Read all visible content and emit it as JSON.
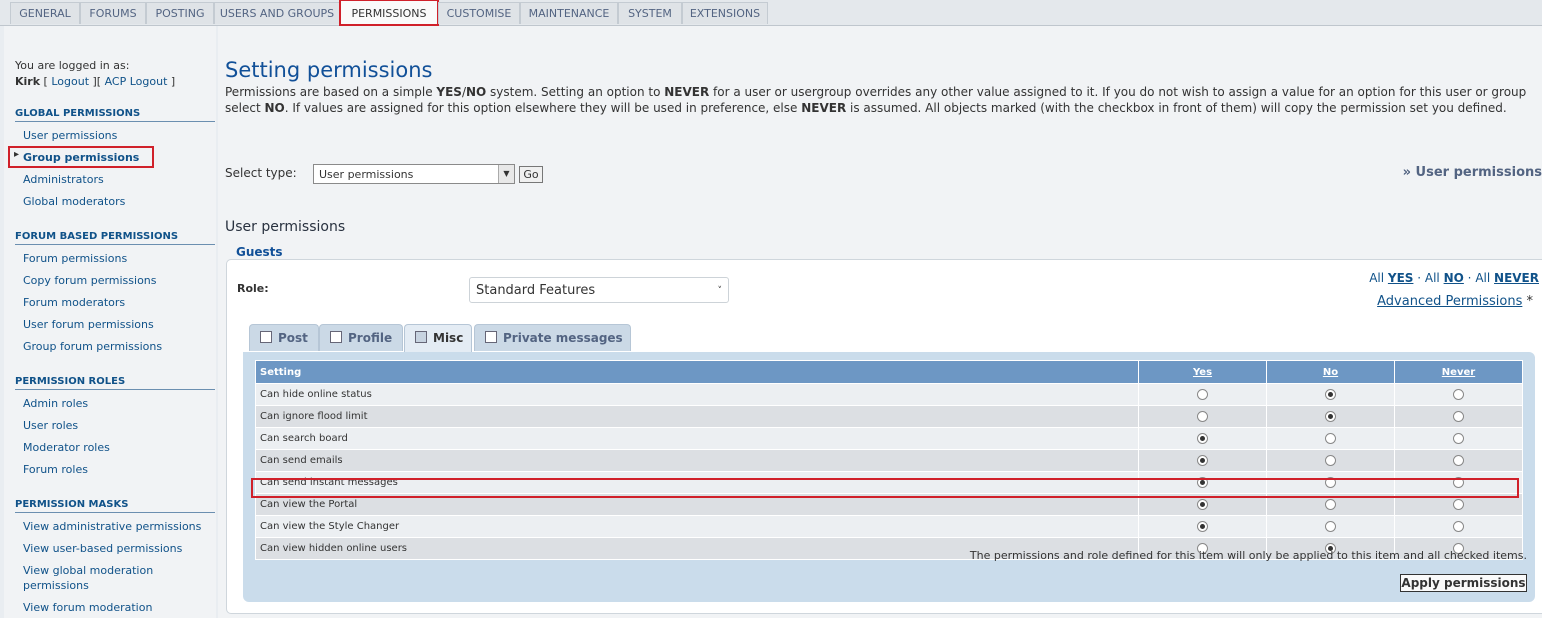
{
  "tabs": [
    "GENERAL",
    "FORUMS",
    "POSTING",
    "USERS AND GROUPS",
    "PERMISSIONS",
    "CUSTOMISE",
    "MAINTENANCE",
    "SYSTEM",
    "EXTENSIONS"
  ],
  "login": {
    "line1": "You are logged in as:",
    "user": "Kirk",
    "logout": "Logout",
    "acp_logout": "ACP Logout"
  },
  "sidebar": {
    "global_h": "GLOBAL PERMISSIONS",
    "global": [
      "User permissions",
      "Group permissions",
      "Administrators",
      "Global moderators"
    ],
    "forum_h": "FORUM BASED PERMISSIONS",
    "forum": [
      "Forum permissions",
      "Copy forum permissions",
      "Forum moderators",
      "User forum permissions",
      "Group forum permissions"
    ],
    "roles_h": "PERMISSION ROLES",
    "roles": [
      "Admin roles",
      "User roles",
      "Moderator roles",
      "Forum roles"
    ],
    "masks_h": "PERMISSION MASKS",
    "masks": [
      "View administrative permissions",
      "View user-based permissions",
      "View global moderation",
      "permissions",
      "View forum moderation"
    ]
  },
  "main": {
    "title": "Setting permissions",
    "intro": [
      {
        "t": "Permissions are based on a simple "
      },
      {
        "b": "YES"
      },
      {
        "t": "/"
      },
      {
        "b": "NO"
      },
      {
        "t": " system. Setting an option to "
      },
      {
        "b": "NEVER"
      },
      {
        "t": " for a user or usergroup overrides any other value assigned to it. If you do not wish to assign a value for an option for this user or group select "
      },
      {
        "b": "NO"
      },
      {
        "t": ". If values are assigned for this option elsewhere they will be used in preference, else "
      },
      {
        "b": "NEVER"
      },
      {
        "t": " is assumed. All objects marked (with the checkbox in front of them) will copy the permission set you defined."
      }
    ],
    "select_type_label": "Select type:",
    "select_type_value": "User permissions",
    "go": "Go",
    "right_link": "» User permissions",
    "section": "User permissions",
    "group": "Guests",
    "role_label": "Role:",
    "role_value": "Standard Features",
    "quick": {
      "all": "All",
      "yes": "YES",
      "no": "NO",
      "never": "NEVER",
      "sep": " · "
    },
    "advanced": "Advanced Permissions",
    "advanced_mark": "*",
    "perm_tabs": [
      "Post",
      "Profile",
      "Misc",
      "Private messages"
    ],
    "active_tab": "Misc",
    "columns": {
      "setting": "Setting",
      "yes": "Yes",
      "no": "No",
      "never": "Never"
    },
    "rows": [
      {
        "label": "Can hide online status",
        "value": "no"
      },
      {
        "label": "Can ignore flood limit",
        "value": "no"
      },
      {
        "label": "Can search board",
        "value": "yes"
      },
      {
        "label": "Can send emails",
        "value": "yes"
      },
      {
        "label": "Can send instant messages",
        "value": "yes"
      },
      {
        "label": "Can view the Portal",
        "value": "yes"
      },
      {
        "label": "Can view the Style Changer",
        "value": "yes"
      },
      {
        "label": "Can view hidden online users",
        "value": "no"
      }
    ],
    "note": "The permissions and role defined for this item will only be applied to this item and all checked items.",
    "apply": "Apply permissions"
  },
  "colors": {
    "highlight": "#d0202a",
    "link": "#105289",
    "header_blue": "#6d97c4"
  }
}
